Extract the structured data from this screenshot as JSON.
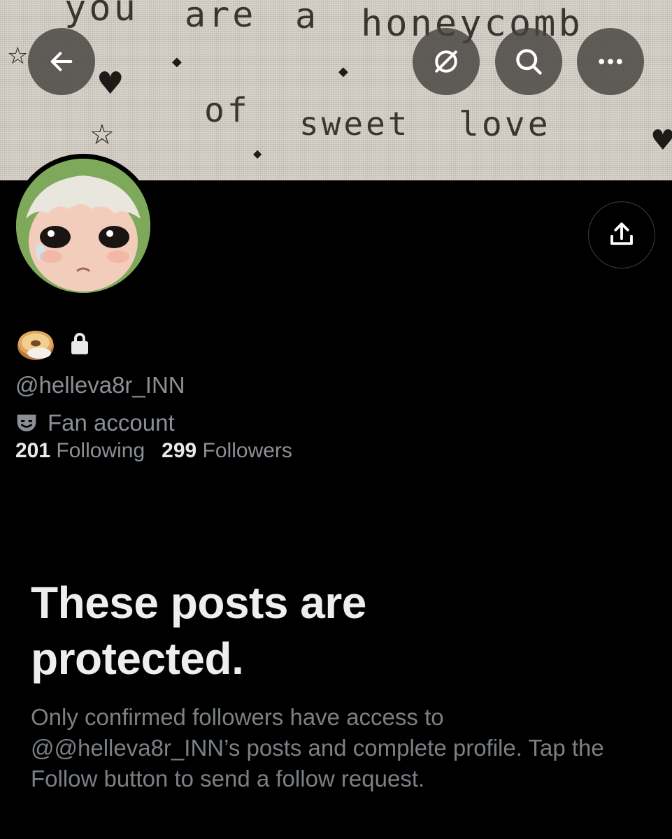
{
  "banner": {
    "line1": [
      "you",
      "are",
      "a",
      "honeycomb"
    ],
    "line2": [
      "of",
      "sweet",
      "love"
    ]
  },
  "toolbar": {
    "back_icon": "arrow-left-icon",
    "grok_icon": "circle-slash-icon",
    "search_icon": "search-icon",
    "more_icon": "more-horizontal-icon"
  },
  "profile": {
    "avatar_alt": "profile avatar",
    "name_emoji": "bagel-emoji",
    "lock_icon": "lock-icon",
    "handle": "@helleva8r_INN",
    "category_icon": "theater-mask-icon",
    "category": "Fan account",
    "following_count": "201",
    "following_label": "Following",
    "followers_count": "299",
    "followers_label": "Followers",
    "share_icon": "share-icon"
  },
  "protected": {
    "title": "These posts are protected.",
    "description": "Only confirmed followers have access to @@helleva8r_INN’s posts and complete profile. Tap the Follow button to send a follow request."
  },
  "colors": {
    "background": "#000000",
    "text_primary": "#e7e9ea",
    "text_secondary": "#8b9096",
    "button_overlay": "#46423e"
  }
}
